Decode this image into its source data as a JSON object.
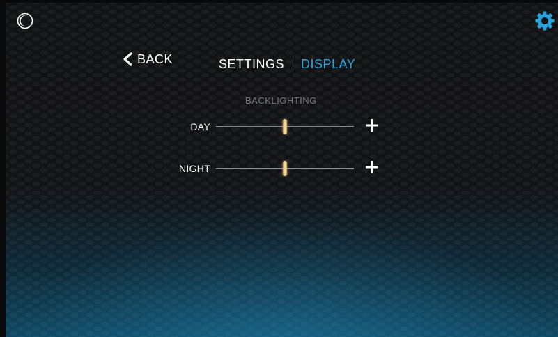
{
  "header": {
    "back_label": "BACK",
    "breadcrumb": {
      "settings_label": "SETTINGS",
      "display_label": "DISPLAY"
    }
  },
  "icons": {
    "top_left": "moon-icon",
    "top_right": "gear-icon",
    "back": "chevron-left-icon",
    "increase": "plus-icon"
  },
  "backlighting": {
    "title": "BACKLIGHTING",
    "sliders": [
      {
        "label": "DAY",
        "level": 0.5
      },
      {
        "label": "NIGHT",
        "level": 0.5
      }
    ]
  },
  "colors": {
    "accent": "#2aa3df",
    "thumb": "#f6e2b3",
    "track": "#8a8a8a"
  }
}
